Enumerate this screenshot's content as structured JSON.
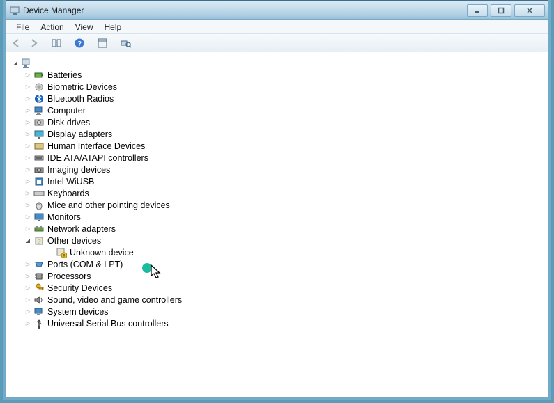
{
  "window": {
    "title": "Device Manager"
  },
  "menu": {
    "file": "File",
    "action": "Action",
    "view": "View",
    "help": "Help"
  },
  "tree": {
    "root": "                    ",
    "batteries": "Batteries",
    "biometric": "Biometric Devices",
    "bluetooth": "Bluetooth Radios",
    "computer": "Computer",
    "disk": "Disk drives",
    "display": "Display adapters",
    "hid": "Human Interface Devices",
    "ide": "IDE ATA/ATAPI controllers",
    "imaging": "Imaging devices",
    "wiusb": "Intel WiUSB",
    "keyboards": "Keyboards",
    "mice": "Mice and other pointing devices",
    "monitors": "Monitors",
    "network": "Network adapters",
    "other": "Other devices",
    "unknown": "Unknown device",
    "ports": "Ports (COM & LPT)",
    "processors": "Processors",
    "security": "Security Devices",
    "sound": "Sound, video and game controllers",
    "system": "System devices",
    "usb": "Universal Serial Bus controllers"
  }
}
